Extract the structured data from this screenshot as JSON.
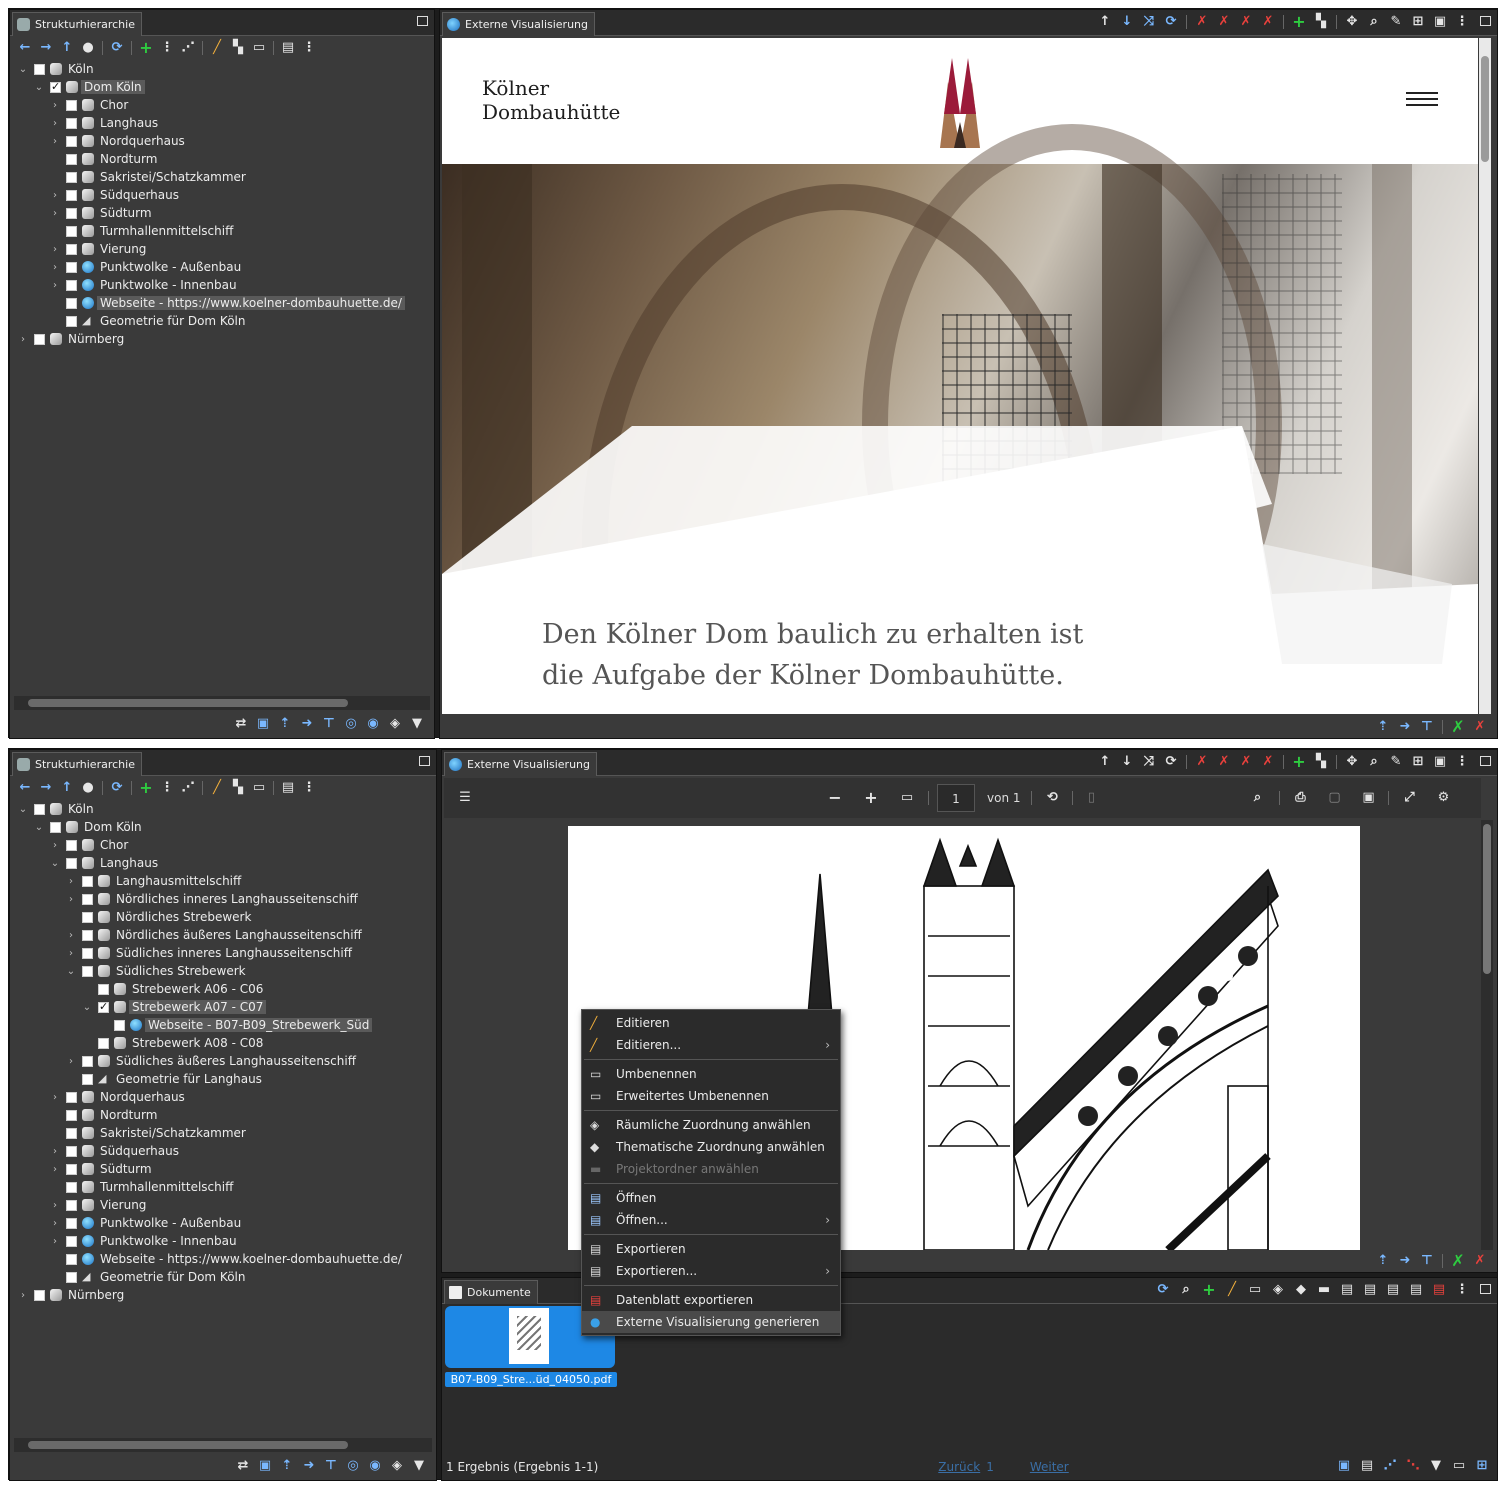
{
  "shot1": {
    "left_panel": {
      "tab_title": "Strukturhierarchie",
      "tree": [
        {
          "label": "Köln",
          "depth": 0,
          "expand": "open",
          "icon": "cube-icon",
          "checked": false,
          "selected": false
        },
        {
          "label": "Dom Köln",
          "depth": 1,
          "expand": "open",
          "icon": "cube-icon",
          "checked": true,
          "selected": true
        },
        {
          "label": "Chor",
          "depth": 2,
          "expand": "closed",
          "icon": "cube-icon",
          "checked": false,
          "selected": false
        },
        {
          "label": "Langhaus",
          "depth": 2,
          "expand": "closed",
          "icon": "cube-icon",
          "checked": false,
          "selected": false
        },
        {
          "label": "Nordquerhaus",
          "depth": 2,
          "expand": "closed",
          "icon": "cube-icon",
          "checked": false,
          "selected": false
        },
        {
          "label": "Nordturm",
          "depth": 2,
          "expand": "none",
          "icon": "cube-icon",
          "checked": false,
          "selected": false
        },
        {
          "label": "Sakristei/Schatzkammer",
          "depth": 2,
          "expand": "none",
          "icon": "cube-icon",
          "checked": false,
          "selected": false
        },
        {
          "label": "Südquerhaus",
          "depth": 2,
          "expand": "closed",
          "icon": "cube-icon",
          "checked": false,
          "selected": false
        },
        {
          "label": "Südturm",
          "depth": 2,
          "expand": "closed",
          "icon": "cube-icon",
          "checked": false,
          "selected": false
        },
        {
          "label": "Turmhallenmittelschiff",
          "depth": 2,
          "expand": "none",
          "icon": "cube-icon",
          "checked": false,
          "selected": false
        },
        {
          "label": "Vierung",
          "depth": 2,
          "expand": "closed",
          "icon": "cube-icon",
          "checked": false,
          "selected": false
        },
        {
          "label": "Punktwolke - Außenbau",
          "depth": 2,
          "expand": "closed",
          "icon": "globe-icon",
          "checked": false,
          "selected": false
        },
        {
          "label": "Punktwolke - Innenbau",
          "depth": 2,
          "expand": "closed",
          "icon": "globe-icon",
          "checked": false,
          "selected": false
        },
        {
          "label": "Webseite - https://www.koelner-dombauhuette.de/",
          "depth": 2,
          "expand": "none",
          "icon": "globe-icon",
          "checked": false,
          "selected": true
        },
        {
          "label": "Geometrie für Dom Köln",
          "depth": 2,
          "expand": "none",
          "icon": "geometry-icon",
          "checked": false,
          "selected": false
        },
        {
          "label": "Nürnberg",
          "depth": 0,
          "expand": "closed",
          "icon": "cube-icon",
          "checked": false,
          "selected": false
        }
      ]
    },
    "right_panel": {
      "tab_title": "Externe Visualisierung",
      "website": {
        "brand_line1": "Kölner",
        "brand_line2": "Dombauhütte",
        "hero_line1": "Den Kölner Dom baulich zu erhalten ist",
        "hero_line2": "die Aufgabe der Kölner Dombauhütte."
      }
    }
  },
  "shot2": {
    "left_panel": {
      "tab_title": "Strukturhierarchie",
      "tree": [
        {
          "label": "Köln",
          "depth": 0,
          "expand": "open",
          "icon": "cube-icon",
          "checked": false,
          "selected": false
        },
        {
          "label": "Dom Köln",
          "depth": 1,
          "expand": "open",
          "icon": "cube-icon",
          "checked": false,
          "selected": false
        },
        {
          "label": "Chor",
          "depth": 2,
          "expand": "closed",
          "icon": "cube-icon",
          "checked": false,
          "selected": false
        },
        {
          "label": "Langhaus",
          "depth": 2,
          "expand": "open",
          "icon": "cube-icon",
          "checked": false,
          "selected": false
        },
        {
          "label": "Langhausmittelschiff",
          "depth": 3,
          "expand": "closed",
          "icon": "cube-icon",
          "checked": false,
          "selected": false
        },
        {
          "label": "Nördliches inneres Langhausseitenschiff",
          "depth": 3,
          "expand": "closed",
          "icon": "cube-icon",
          "checked": false,
          "selected": false
        },
        {
          "label": "Nördliches Strebewerk",
          "depth": 3,
          "expand": "none",
          "icon": "cube-icon",
          "checked": false,
          "selected": false
        },
        {
          "label": "Nördliches äußeres Langhausseitenschiff",
          "depth": 3,
          "expand": "closed",
          "icon": "cube-icon",
          "checked": false,
          "selected": false
        },
        {
          "label": "Südliches inneres Langhausseitenschiff",
          "depth": 3,
          "expand": "closed",
          "icon": "cube-icon",
          "checked": false,
          "selected": false
        },
        {
          "label": "Südliches Strebewerk",
          "depth": 3,
          "expand": "open",
          "icon": "cube-icon",
          "checked": false,
          "selected": false
        },
        {
          "label": "Strebewerk A06 - C06",
          "depth": 4,
          "expand": "none",
          "icon": "cube-icon",
          "checked": false,
          "selected": false
        },
        {
          "label": "Strebewerk A07 - C07",
          "depth": 4,
          "expand": "open",
          "icon": "cube-icon",
          "checked": true,
          "selected": true
        },
        {
          "label": "Webseite - B07-B09_Strebewerk_Süd",
          "depth": 5,
          "expand": "none",
          "icon": "globe-icon",
          "checked": false,
          "selected": true
        },
        {
          "label": "Strebewerk A08 - C08",
          "depth": 4,
          "expand": "none",
          "icon": "cube-icon",
          "checked": false,
          "selected": false
        },
        {
          "label": "Südliches äußeres Langhausseitenschiff",
          "depth": 3,
          "expand": "closed",
          "icon": "cube-icon",
          "checked": false,
          "selected": false
        },
        {
          "label": "Geometrie für Langhaus",
          "depth": 3,
          "expand": "none",
          "icon": "geometry-icon",
          "checked": false,
          "selected": false
        },
        {
          "label": "Nordquerhaus",
          "depth": 2,
          "expand": "closed",
          "icon": "cube-icon",
          "checked": false,
          "selected": false
        },
        {
          "label": "Nordturm",
          "depth": 2,
          "expand": "none",
          "icon": "cube-icon",
          "checked": false,
          "selected": false
        },
        {
          "label": "Sakristei/Schatzkammer",
          "depth": 2,
          "expand": "none",
          "icon": "cube-icon",
          "checked": false,
          "selected": false
        },
        {
          "label": "Südquerhaus",
          "depth": 2,
          "expand": "closed",
          "icon": "cube-icon",
          "checked": false,
          "selected": false
        },
        {
          "label": "Südturm",
          "depth": 2,
          "expand": "closed",
          "icon": "cube-icon",
          "checked": false,
          "selected": false
        },
        {
          "label": "Turmhallenmittelschiff",
          "depth": 2,
          "expand": "none",
          "icon": "cube-icon",
          "checked": false,
          "selected": false
        },
        {
          "label": "Vierung",
          "depth": 2,
          "expand": "closed",
          "icon": "cube-icon",
          "checked": false,
          "selected": false
        },
        {
          "label": "Punktwolke - Außenbau",
          "depth": 2,
          "expand": "closed",
          "icon": "globe-icon",
          "checked": false,
          "selected": false
        },
        {
          "label": "Punktwolke - Innenbau",
          "depth": 2,
          "expand": "closed",
          "icon": "globe-icon",
          "checked": false,
          "selected": false
        },
        {
          "label": "Webseite - https://www.koelner-dombauhuette.de/",
          "depth": 2,
          "expand": "none",
          "icon": "globe-icon",
          "checked": false,
          "selected": false
        },
        {
          "label": "Geometrie für Dom Köln",
          "depth": 2,
          "expand": "none",
          "icon": "geometry-icon",
          "checked": false,
          "selected": false
        },
        {
          "label": "Nürnberg",
          "depth": 0,
          "expand": "closed",
          "icon": "cube-icon",
          "checked": false,
          "selected": false
        }
      ]
    },
    "viewer": {
      "tab_title": "Externe Visualisierung",
      "page_number": "1",
      "page_of": "von 1",
      "zoom_out": "−",
      "zoom_in": "+"
    },
    "context_menu": {
      "items": [
        {
          "label": "Editieren",
          "icon": "pencil-icon",
          "submenu": true,
          "disabled": false,
          "highlight": false
        },
        {
          "label": "Editieren...",
          "icon": "pencil-icon",
          "submenu": true,
          "disabled": false,
          "highlight": false
        },
        {
          "sep": true
        },
        {
          "label": "Umbenennen",
          "icon": "rename-icon",
          "submenu": false,
          "disabled": false,
          "highlight": false
        },
        {
          "label": "Erweitertes Umbenennen",
          "icon": "rename-icon",
          "submenu": false,
          "disabled": false,
          "highlight": false
        },
        {
          "sep": true
        },
        {
          "label": "Räumliche Zuordnung anwählen",
          "icon": "cube-icon",
          "submenu": false,
          "disabled": false,
          "highlight": false
        },
        {
          "label": "Thematische Zuordnung anwählen",
          "icon": "tag-icon",
          "submenu": false,
          "disabled": false,
          "highlight": false
        },
        {
          "label": "Projektordner anwählen",
          "icon": "folder-icon",
          "submenu": false,
          "disabled": true,
          "highlight": false
        },
        {
          "sep": true
        },
        {
          "label": "Öffnen",
          "icon": "open-file-icon",
          "submenu": false,
          "disabled": false,
          "highlight": false
        },
        {
          "label": "Öffnen...",
          "icon": "open-file-icon",
          "submenu": true,
          "disabled": false,
          "highlight": false
        },
        {
          "sep": true
        },
        {
          "label": "Exportieren",
          "icon": "export-icon",
          "submenu": false,
          "disabled": false,
          "highlight": false
        },
        {
          "label": "Exportieren...",
          "icon": "export-icon",
          "submenu": true,
          "disabled": false,
          "highlight": false
        },
        {
          "sep": true
        },
        {
          "label": "Datenblatt exportieren",
          "icon": "pdf-icon",
          "submenu": false,
          "disabled": false,
          "highlight": false
        },
        {
          "label": "Externe Visualisierung generieren",
          "icon": "globe-icon",
          "submenu": false,
          "disabled": false,
          "highlight": true
        }
      ]
    },
    "documents": {
      "tab_title": "Dokumente",
      "file_name": "B07-B09_Stre...üd_04050.pdf",
      "status": "1 Ergebnis (Ergebnis 1-1)",
      "back_link": "Zurück",
      "page_link": "1",
      "next_link": "Weiter"
    }
  },
  "colors": {
    "selection_blue": "#1e88e5",
    "panel_dark": "#3a3a3a",
    "toolbar_dark": "#2b2b2b",
    "logo_red": "#9b1b3a",
    "logo_brown": "#a77550"
  }
}
